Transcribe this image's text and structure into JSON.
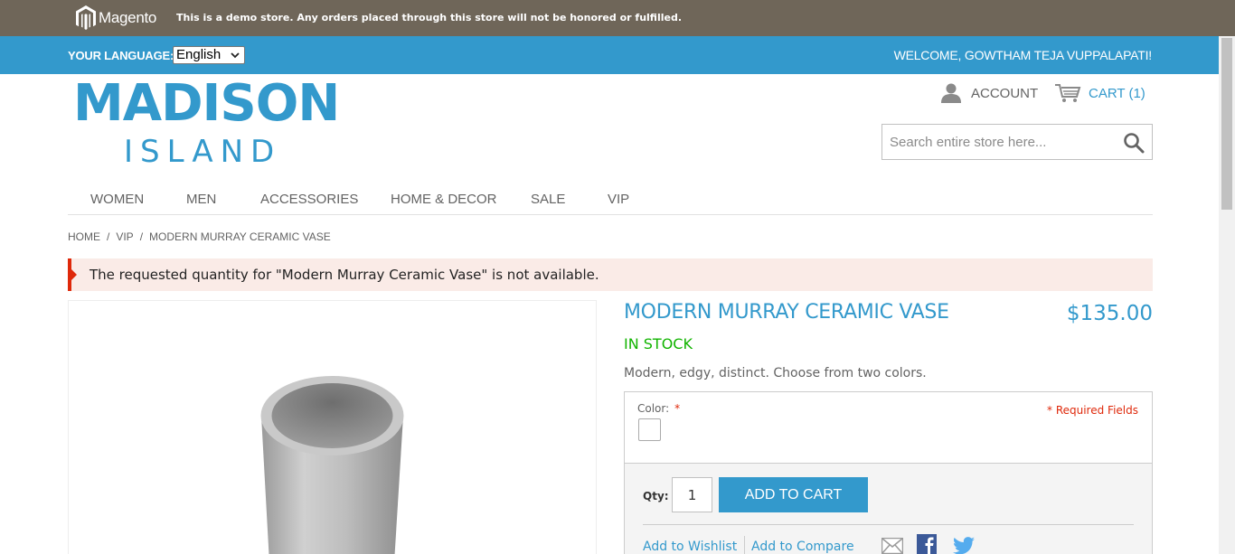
{
  "demo_notice": {
    "brand": "Magento",
    "text": "This is a demo store. Any orders placed through this store will not be honored or fulfilled."
  },
  "top_bar": {
    "language_label": "YOUR LANGUAGE:",
    "language_selected": "English",
    "welcome": "WELCOME, GOWTHAM TEJA VUPPALAPATI!"
  },
  "logo": {
    "line1": "MADISON",
    "line2": "ISLAND"
  },
  "header": {
    "account_label": "ACCOUNT",
    "cart_label": "CART (1)",
    "search_placeholder": "Search entire store here..."
  },
  "nav": [
    "WOMEN",
    "MEN",
    "ACCESSORIES",
    "HOME & DECOR",
    "SALE",
    "VIP"
  ],
  "breadcrumb": {
    "home": "HOME",
    "sep1": "/",
    "vip": "VIP",
    "sep2": "/",
    "current": "MODERN MURRAY CERAMIC VASE"
  },
  "error_message": "The requested quantity for \"Modern Murray Ceramic Vase\" is not available.",
  "product": {
    "name": "MODERN MURRAY CERAMIC VASE",
    "price": "$135.00",
    "stock": "IN STOCK",
    "short_description": "Modern, edgy, distinct. Choose from two colors.",
    "color_label": "Color:",
    "required_star": "*",
    "required_fields": "* Required Fields",
    "qty_label": "Qty:",
    "qty_value": "1",
    "add_to_cart": "ADD TO CART",
    "add_to_wishlist": "Add to Wishlist",
    "add_to_compare": "Add to Compare"
  },
  "colors": {
    "brand_blue": "#3399cc",
    "demo_bar": "#6f6659",
    "error": "#df280a",
    "in_stock": "#11b400"
  }
}
